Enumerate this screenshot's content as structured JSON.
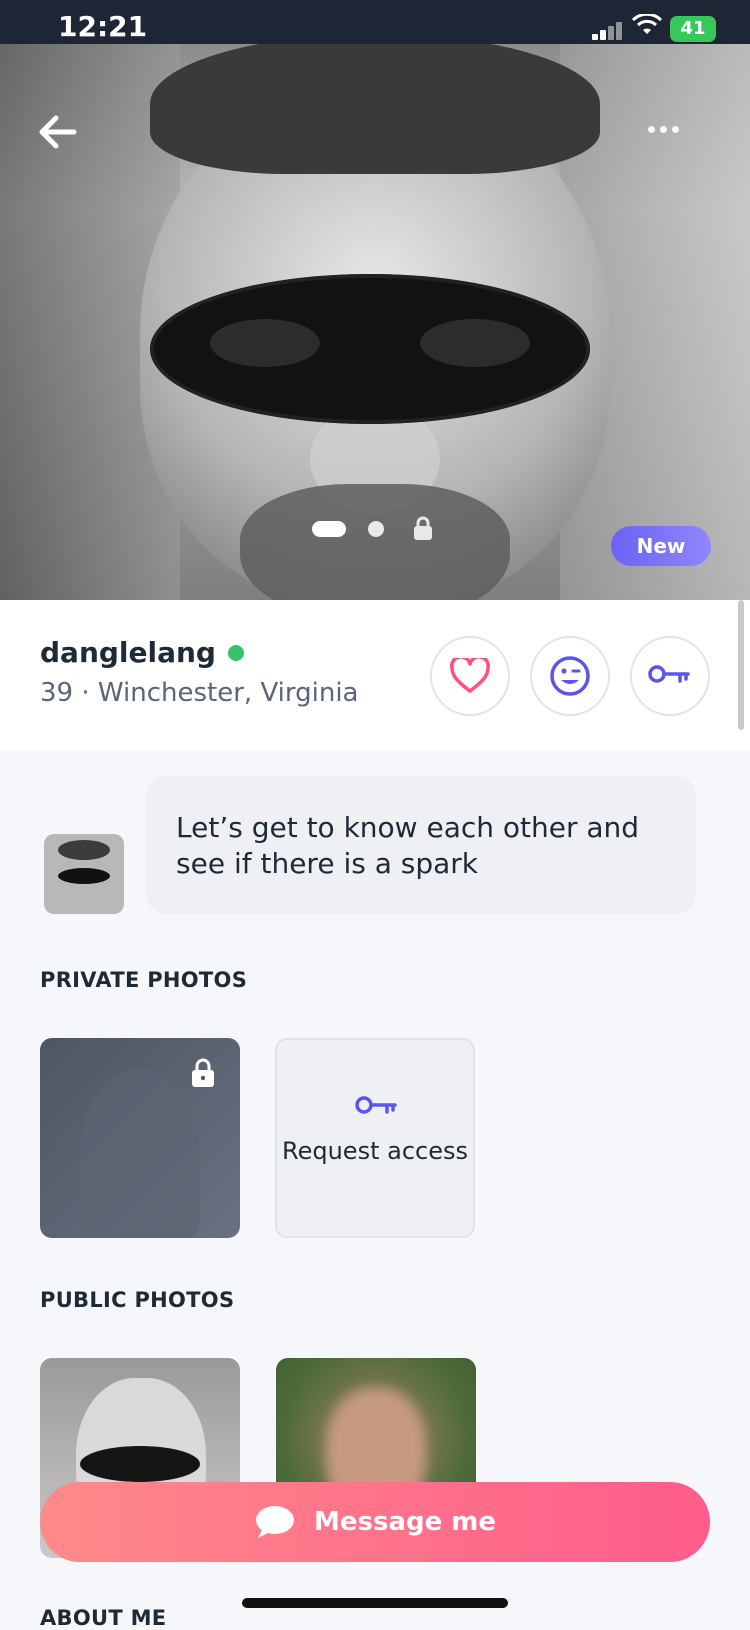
{
  "status_bar": {
    "time": "12:21",
    "battery": "41"
  },
  "hero": {
    "badge": "New",
    "page_indicator": {
      "count": 3,
      "active_index": 0,
      "locked_index": 2
    }
  },
  "profile": {
    "username": "danglelang",
    "online": true,
    "meta": "39 · Winchester, Virginia",
    "actions": [
      {
        "icon": "heart-icon",
        "color": "#ff4f7a"
      },
      {
        "icon": "wink-icon",
        "color": "#5b55ee"
      },
      {
        "icon": "key-icon",
        "color": "#5b55ee"
      }
    ]
  },
  "intro_message": "Let’s get to know each other and see if there is a spark",
  "sections": {
    "private_title": "PRIVATE PHOTOS",
    "request_access": "Request access",
    "public_title": "PUBLIC PHOTOS",
    "about_title": "ABOUT ME"
  },
  "cta": {
    "label": "Message me"
  },
  "colors": {
    "accent": "#5b55ee",
    "cta_start": "#ff8a8a",
    "cta_end": "#ff5c8a",
    "online": "#35c46a"
  }
}
